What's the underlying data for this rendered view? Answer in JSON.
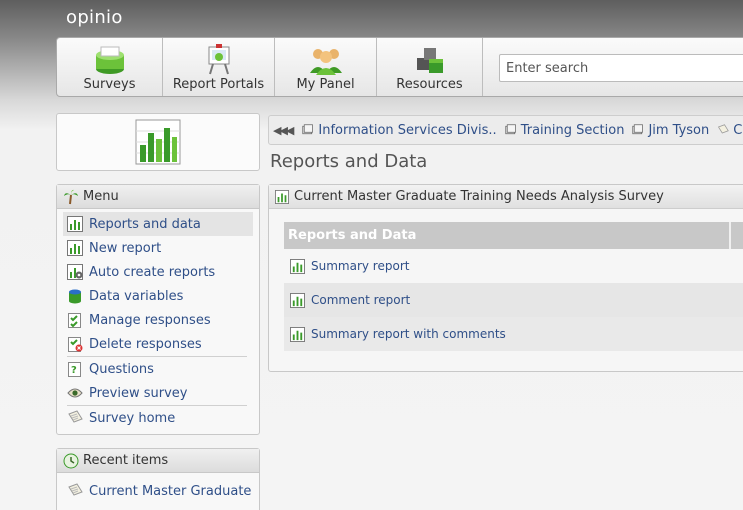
{
  "app": {
    "title": "opinio"
  },
  "nav": {
    "items": [
      {
        "label": "Surveys",
        "icon": "surveys-icon"
      },
      {
        "label": "Report Portals",
        "icon": "report-portals-icon"
      },
      {
        "label": "My Panel",
        "icon": "my-panel-icon"
      },
      {
        "label": "Resources",
        "icon": "resources-icon"
      }
    ],
    "search_placeholder": "Enter search"
  },
  "menu": {
    "title": "Menu",
    "items": [
      {
        "label": "Reports and data",
        "icon": "chart-icon"
      },
      {
        "label": "New report",
        "icon": "chart-icon"
      },
      {
        "label": "Auto create reports",
        "icon": "chart-gear-icon"
      },
      {
        "label": "Data variables",
        "icon": "database-icon"
      },
      {
        "label": "Manage responses",
        "icon": "checklist-icon"
      },
      {
        "label": "Delete responses",
        "icon": "checklist-delete-icon"
      },
      {
        "label": "Questions",
        "icon": "question-icon"
      },
      {
        "label": "Preview survey",
        "icon": "eye-icon"
      },
      {
        "label": "Survey home",
        "icon": "document-icon"
      }
    ]
  },
  "recent": {
    "title": "Recent items",
    "items": [
      {
        "label": "Current Master Graduate Tr"
      }
    ]
  },
  "breadcrumb": {
    "items": [
      "Information Services Divis..",
      "Training Section",
      "Jim Tyson",
      "Curr"
    ]
  },
  "page": {
    "title": "Reports and Data"
  },
  "content": {
    "survey_title": "Current Master Graduate Training Needs Analysis Survey",
    "table_header": "Reports and Data",
    "reports": [
      {
        "label": "Summary report"
      },
      {
        "label": "Comment report"
      },
      {
        "label": "Summary report with comments"
      }
    ]
  },
  "colors": {
    "link": "#2f4f88",
    "accent_green": "#3a9a2a",
    "header_gray": "#c8c8c8"
  }
}
